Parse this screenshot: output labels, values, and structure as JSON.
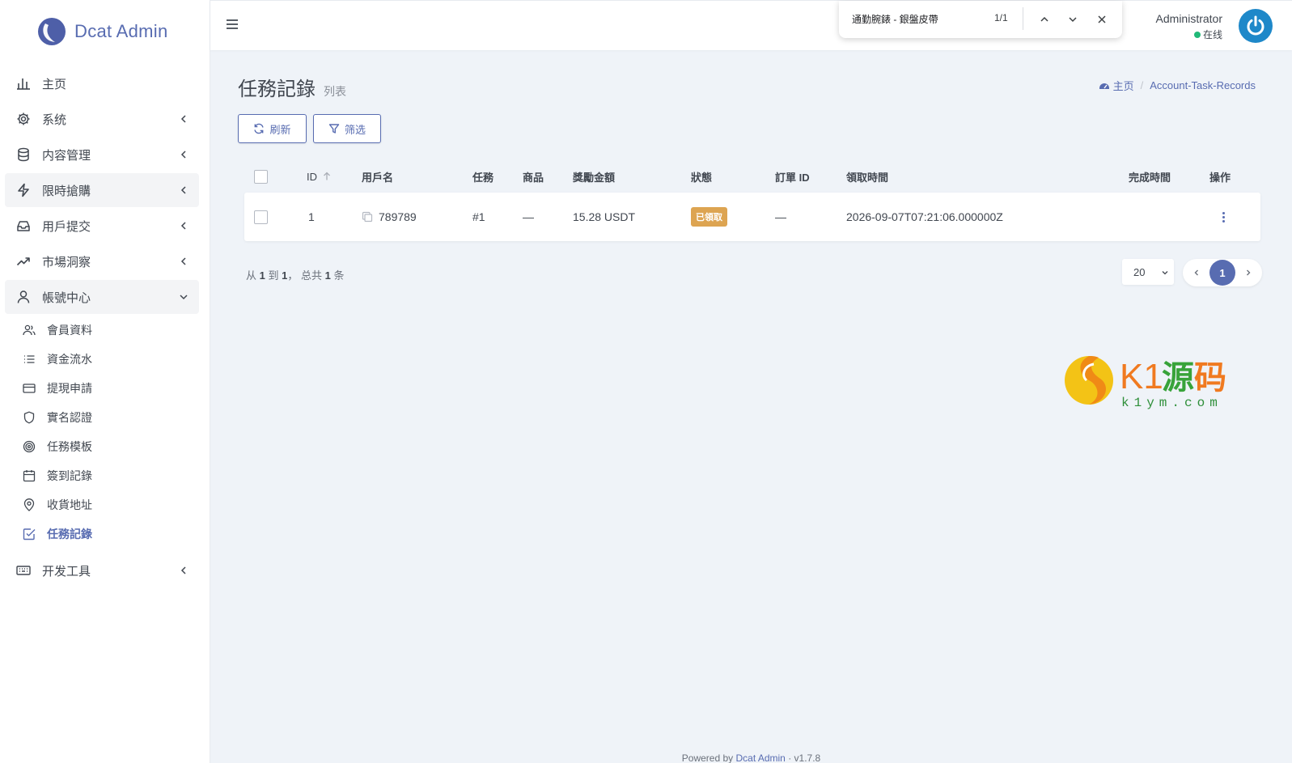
{
  "brand": {
    "name": "Dcat Admin"
  },
  "menu": {
    "items": [
      {
        "label": "主页",
        "icon": "bar-chart-icon"
      },
      {
        "label": "系统",
        "icon": "gear-icon"
      },
      {
        "label": "内容管理",
        "icon": "database-icon"
      },
      {
        "label": "限時搶購",
        "icon": "lightning-icon"
      },
      {
        "label": "用戶提交",
        "icon": "inbox-icon"
      },
      {
        "label": "市場洞察",
        "icon": "trending-up-icon"
      },
      {
        "label": "帳號中心",
        "icon": "user-icon"
      }
    ],
    "sub_items": [
      {
        "label": "會員資料",
        "icon": "users-icon"
      },
      {
        "label": "資金流水",
        "icon": "list-icon"
      },
      {
        "label": "提現申請",
        "icon": "credit-card-icon"
      },
      {
        "label": "實名認證",
        "icon": "shield-icon"
      },
      {
        "label": "任務模板",
        "icon": "target-icon"
      },
      {
        "label": "簽到記錄",
        "icon": "calendar-icon"
      },
      {
        "label": "收貨地址",
        "icon": "map-pin-icon"
      },
      {
        "label": "任務記錄",
        "icon": "check-square-icon"
      }
    ],
    "dev_tools": {
      "label": "开发工具",
      "icon": "keyboard-icon"
    }
  },
  "findbar": {
    "query": "通勤腕錶 - 銀盤皮帶",
    "count": "1/1"
  },
  "user": {
    "name": "Administrator",
    "status": "在线"
  },
  "page": {
    "title": "任務記錄",
    "subtitle": "列表"
  },
  "breadcrumb": {
    "home": "主页",
    "current": "Account-Task-Records"
  },
  "toolbar": {
    "refresh": "刷新",
    "filter": "筛选"
  },
  "table": {
    "headers": {
      "id": "ID",
      "username": "用戶名",
      "task": "任務",
      "product": "商品",
      "reward": "獎勵金額",
      "status": "狀態",
      "order_id": "訂單 ID",
      "claimed_at": "領取時間",
      "completed_at": "完成時間",
      "actions": "操作"
    },
    "rows": [
      {
        "id": "1",
        "username": "789789",
        "task": "#1",
        "product": "—",
        "reward": "15.28 USDT",
        "status": "已領取",
        "order_id": "—",
        "claimed_at": "2026-09-07T07:21:06.000000Z",
        "completed_at": ""
      }
    ]
  },
  "pagination": {
    "from_prefix": "从",
    "from": "1",
    "to_word": "到",
    "to": "1",
    "total_prefix": "， 总共",
    "total": "1",
    "total_suffix": "条",
    "per_page": "20",
    "current_page": "1"
  },
  "footer": {
    "prefix": "Powered by",
    "link": "Dcat Admin",
    "sep": "·",
    "version": "v1.7.8"
  },
  "colors": {
    "primary": "#586cb1",
    "badge": "#dda451",
    "online": "#21b978",
    "background": "#eff3f8"
  },
  "watermark": {
    "text": "K1源码",
    "url": "k1ym.com"
  }
}
